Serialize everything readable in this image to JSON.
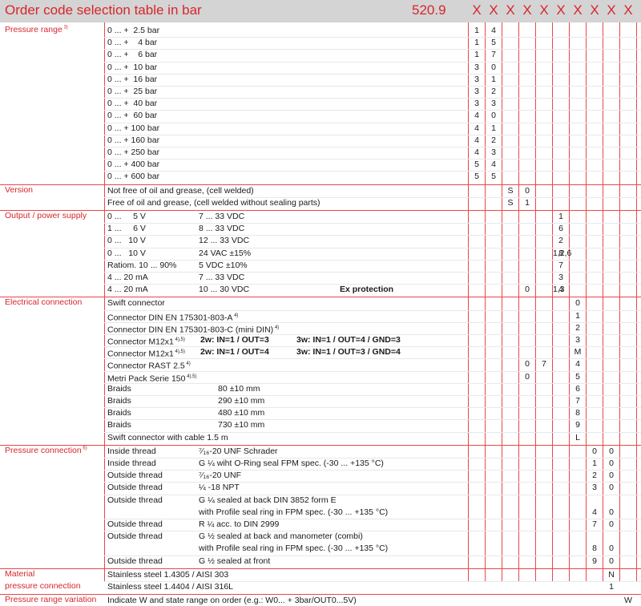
{
  "header": {
    "title": "Order code selection table in bar",
    "model": "520.9",
    "x_mark": "X"
  },
  "sections": {
    "pressure_range": "Pressure range",
    "pressure_range_note": "3)",
    "version": "Version",
    "output": "Output / power supply",
    "electrical": "Electrical connection",
    "pressure_connection": "Pressure connection",
    "pressure_connection_note": "6)",
    "material": "Material",
    "material_sub": "pressure connection",
    "variation": "Pressure range variation"
  },
  "pressure_rows": [
    {
      "range": "0 ... +  2.5 bar",
      "c1": "1",
      "c2": "4"
    },
    {
      "range": "0 ... +    4 bar",
      "c1": "1",
      "c2": "5"
    },
    {
      "range": "0 ... +    6 bar",
      "c1": "1",
      "c2": "7"
    },
    {
      "range": "0 ... +  10 bar",
      "c1": "3",
      "c2": "0"
    },
    {
      "range": "0 ... +  16 bar",
      "c1": "3",
      "c2": "1"
    },
    {
      "range": "0 ... +  25 bar",
      "c1": "3",
      "c2": "2"
    },
    {
      "range": "0 ... +  40 bar",
      "c1": "3",
      "c2": "3"
    },
    {
      "range": "0 ... +  60 bar",
      "c1": "4",
      "c2": "0"
    },
    {
      "range": "0 ... + 100 bar",
      "c1": "4",
      "c2": "1"
    },
    {
      "range": "0 ... + 160 bar",
      "c1": "4",
      "c2": "2"
    },
    {
      "range": "0 ... + 250 bar",
      "c1": "4",
      "c2": "3"
    },
    {
      "range": "0 ... + 400 bar",
      "c1": "5",
      "c2": "4"
    },
    {
      "range": "0 ... + 600 bar",
      "c1": "5",
      "c2": "5"
    }
  ],
  "version_rows": [
    {
      "text": "Not free of oil and grease, (cell welded)",
      "c1": "S",
      "c2": "0"
    },
    {
      "text": "Free of oil and grease, (cell welded without sealing parts)",
      "c1": "S",
      "c2": "1"
    }
  ],
  "output_rows": [
    {
      "a": "0 ...     5 V",
      "b": "7 ... 33 VDC",
      "extra": "",
      "code": "1",
      "code2": "",
      "p1": "",
      "p2": ""
    },
    {
      "a": "1 ...     6 V",
      "b": "8 ... 33 VDC",
      "extra": "",
      "code": "6",
      "code2": "",
      "p1": "",
      "p2": ""
    },
    {
      "a": "0 ...   10 V",
      "b": "12 ... 33 VDC",
      "extra": "",
      "code": "2",
      "code2": "",
      "p1": "",
      "p2": ""
    },
    {
      "a": "0 ...   10 V",
      "b": "24 VAC ±15%",
      "extra": "",
      "code": "8",
      "code2": "1,2,6",
      "p1": "",
      "p2": ""
    },
    {
      "a": "Ratiom. 10 ... 90%",
      "b": "5 VDC ±10%",
      "extra": "",
      "code": "7",
      "code2": "",
      "p1": "",
      "p2": ""
    },
    {
      "a": "4 ... 20 mA",
      "b": "7 ... 33 VDC",
      "extra": "",
      "code": "3",
      "code2": "",
      "p1": "",
      "p2": ""
    },
    {
      "a": "4 ... 20 mA",
      "b": "10 ... 30 VDC",
      "extra": "Ex protection",
      "code": "4",
      "code2": "1,3",
      "p1": "0",
      "p2": ""
    }
  ],
  "electrical_rows": [
    {
      "a": "Swift connector",
      "sup": "",
      "b": "",
      "c": "",
      "code": "0",
      "p1": "",
      "p2": ""
    },
    {
      "a": "Connector DIN EN 175301-803-A",
      "sup": "4)",
      "b": "",
      "c": "",
      "code": "1",
      "p1": "",
      "p2": ""
    },
    {
      "a": "Connector DIN EN 175301-803-C (mini DIN)",
      "sup": "4)",
      "b": "",
      "c": "",
      "code": "2",
      "p1": "",
      "p2": ""
    },
    {
      "a": "Connector M12x1",
      "sup": "4),5)",
      "b": "2w: IN=1 / OUT=3",
      "c": "3w: IN=1 / OUT=4 / GND=3",
      "code": "3",
      "p1": "",
      "p2": ""
    },
    {
      "a": "Connector M12x1",
      "sup": "4),5)",
      "b": "2w: IN=1 / OUT=4",
      "c": "3w: IN=1 / OUT=3 / GND=4",
      "code": "M",
      "p1": "",
      "p2": ""
    },
    {
      "a": "Connector RAST 2.5",
      "sup": "4)",
      "b": "",
      "c": "",
      "code": "4",
      "p1": "0",
      "p2": "7"
    },
    {
      "a": "Metri Pack Serie 150",
      "sup": "4),5)",
      "b": "",
      "c": "",
      "code": "5",
      "p1": "0",
      "p2": ""
    },
    {
      "a": "Braids",
      "sup": "",
      "b": "80 ±10 mm",
      "c": "",
      "code": "6",
      "p1": "",
      "p2": ""
    },
    {
      "a": "Braids",
      "sup": "",
      "b": "290 ±10 mm",
      "c": "",
      "code": "7",
      "p1": "",
      "p2": ""
    },
    {
      "a": "Braids",
      "sup": "",
      "b": "480 ±10 mm",
      "c": "",
      "code": "8",
      "p1": "",
      "p2": ""
    },
    {
      "a": "Braids",
      "sup": "",
      "b": "730 ±10 mm",
      "c": "",
      "code": "9",
      "p1": "",
      "p2": ""
    },
    {
      "a": "Swift connector with cable 1.5 m",
      "sup": "",
      "b": "",
      "c": "",
      "code": "L",
      "p1": "",
      "p2": ""
    }
  ],
  "connection_rows": [
    {
      "a": "Inside thread",
      "l1": "⁷⁄₁₆-20 UNF Schrader",
      "l2": "",
      "c1": "0",
      "c2": "0"
    },
    {
      "a": "Inside thread",
      "l1": "G ¼ wiht O-Ring seal FPM spec. (-30 ... +135 °C)",
      "l2": "",
      "c1": "1",
      "c2": "0"
    },
    {
      "a": "Outside thread",
      "l1": "⁷⁄₁₆-20 UNF",
      "l2": "",
      "c1": "2",
      "c2": "0"
    },
    {
      "a": "Outside thread",
      "l1": "¼ -18 NPT",
      "l2": "",
      "c1": "3",
      "c2": "0"
    },
    {
      "a": "Outside thread",
      "l1": "G ¼ sealed at back DIN 3852 form E",
      "l2": "with Profile seal ring in FPM spec. (-30 ... +135 °C)",
      "c1": "4",
      "c2": "0"
    },
    {
      "a": "Outside thread",
      "l1": "R ¼ acc. to DIN 2999",
      "l2": "",
      "c1": "7",
      "c2": "0"
    },
    {
      "a": "Outside thread",
      "l1": "G ½ sealed at back and manometer (combi)",
      "l2": "with Profile seal ring in FPM spec. (-30 ... +135 °C)",
      "c1": "8",
      "c2": "0"
    },
    {
      "a": "Outside thread",
      "l1": "G ½ sealed at front",
      "l2": "",
      "c1": "9",
      "c2": "0"
    }
  ],
  "material_rows": [
    {
      "text": "Stainless steel 1.4305 / AISI 303",
      "code": "N"
    },
    {
      "text": "Stainless steel 1.4404 / AISI 316L",
      "code": "1"
    }
  ],
  "variation": {
    "text": "Indicate W and state range on order (e.g.: W0... + 3bar/OUT0...5V)",
    "code": "W"
  }
}
